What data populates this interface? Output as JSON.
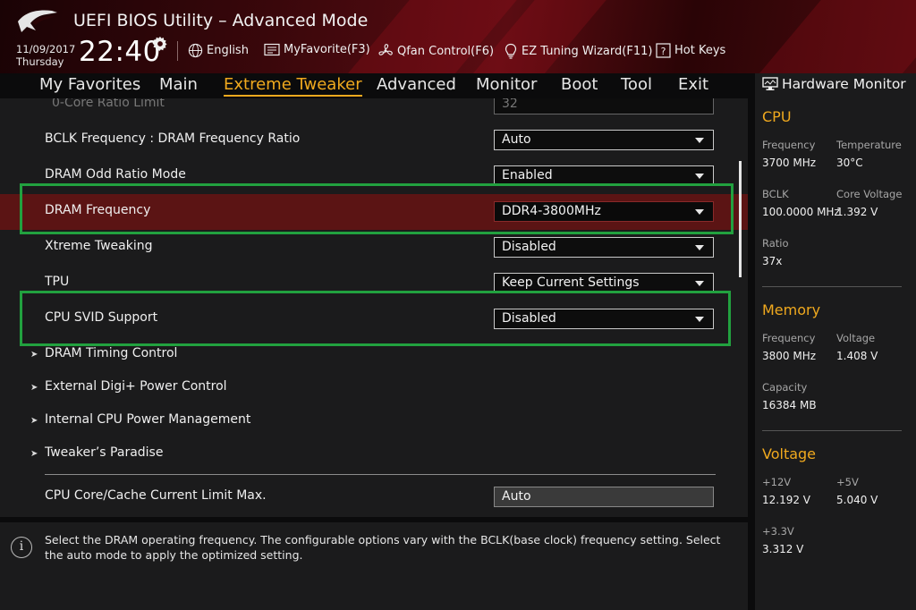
{
  "header": {
    "title": "UEFI BIOS Utility – Advanced Mode",
    "date": "11/09/2017",
    "day": "Thursday",
    "time": "22:40",
    "items": [
      {
        "label": "English",
        "icon": "globe-icon"
      },
      {
        "label": "MyFavorite(F3)",
        "icon": "favorite-icon"
      },
      {
        "label": "Qfan Control(F6)",
        "icon": "fan-icon"
      },
      {
        "label": "EZ Tuning Wizard(F11)",
        "icon": "lightbulb-icon"
      },
      {
        "label": "Hot Keys",
        "icon": "hotkeys-icon"
      }
    ]
  },
  "tabs": [
    "My Favorites",
    "Main",
    "Extreme Tweaker",
    "Advanced",
    "Monitor",
    "Boot",
    "Tool",
    "Exit"
  ],
  "active_tab": "Extreme Tweaker",
  "settings": [
    {
      "label": "0-Core Ratio Limit",
      "value": "32",
      "type": "field",
      "state": "partial"
    },
    {
      "label": "BCLK Frequency : DRAM Frequency Ratio",
      "value": "Auto",
      "type": "dropdown"
    },
    {
      "label": "DRAM Odd Ratio Mode",
      "value": "Enabled",
      "type": "dropdown"
    },
    {
      "label": "DRAM Frequency",
      "value": "DDR4-3800MHz",
      "type": "dropdown",
      "selected": true
    },
    {
      "label": "Xtreme Tweaking",
      "value": "Disabled",
      "type": "dropdown"
    },
    {
      "label": "TPU",
      "value": "Keep Current Settings",
      "type": "dropdown"
    },
    {
      "label": "CPU SVID Support",
      "value": "Disabled",
      "type": "dropdown"
    }
  ],
  "submenus": [
    "DRAM Timing Control",
    "External Digi+ Power Control",
    "Internal CPU Power Management",
    "Tweaker’s Paradise"
  ],
  "bottom_setting": {
    "label": "CPU Core/Cache Current Limit Max.",
    "value": "Auto"
  },
  "help_text": "Select the DRAM operating frequency. The configurable options vary with the BCLK(base clock) frequency setting. Select the auto mode to apply the optimized setting.",
  "hardware_monitor": {
    "title": "Hardware Monitor",
    "cpu": {
      "heading": "CPU",
      "frequency_label": "Frequency",
      "frequency": "3700 MHz",
      "temperature_label": "Temperature",
      "temperature": "30°C",
      "bclk_label": "BCLK",
      "bclk": "100.0000 MHz",
      "core_voltage_label": "Core Voltage",
      "core_voltage": "1.392 V",
      "ratio_label": "Ratio",
      "ratio": "37x"
    },
    "memory": {
      "heading": "Memory",
      "frequency_label": "Frequency",
      "frequency": "3800 MHz",
      "voltage_label": "Voltage",
      "voltage": "1.408 V",
      "capacity_label": "Capacity",
      "capacity": "16384 MB"
    },
    "voltage": {
      "heading": "Voltage",
      "v12_label": "+12V",
      "v12": "12.192 V",
      "v5_label": "+5V",
      "v5": "5.040 V",
      "v33_label": "+3.3V",
      "v33": "3.312 V"
    }
  },
  "colors": {
    "accent": "#f0a91e",
    "highlight_row": "#5b1414",
    "annotation_box": "#22a13f",
    "header_red": "#5a0c12"
  }
}
